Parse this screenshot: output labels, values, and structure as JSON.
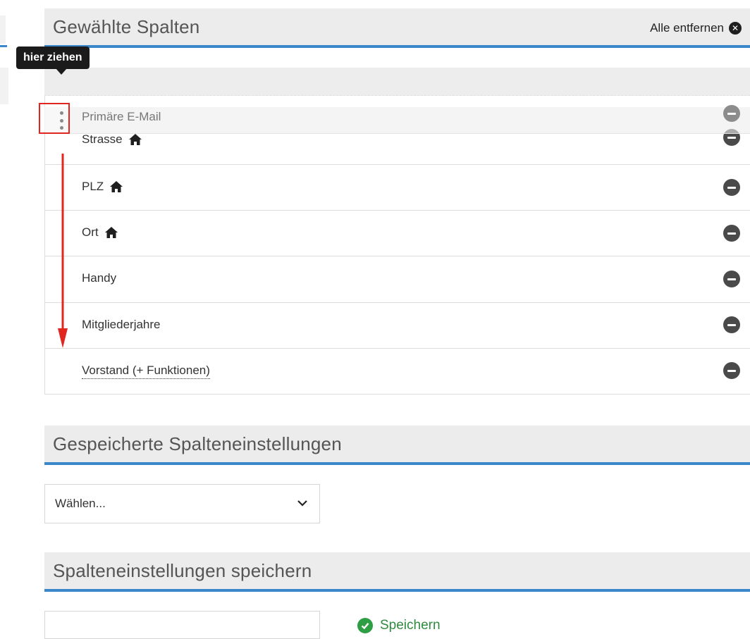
{
  "selected_columns": {
    "title": "Gewählte Spalten",
    "remove_all_label": "Alle entfernen",
    "drag_tooltip": "hier ziehen",
    "dragged_item": "Primäre E-Mail",
    "items": [
      {
        "label": "Strasse",
        "icon": "home-icon"
      },
      {
        "label": "PLZ",
        "icon": "home-icon"
      },
      {
        "label": "Ort",
        "icon": "home-icon"
      },
      {
        "label": "Handy",
        "icon": ""
      },
      {
        "label": "Mitgliederjahre",
        "icon": ""
      },
      {
        "label": "Vorstand (+ Funktionen)",
        "icon": ""
      }
    ]
  },
  "saved_settings": {
    "title": "Gespeicherte Spalteneinstellungen",
    "select_value": "Wählen..."
  },
  "save_settings": {
    "title": "Spalteneinstellungen speichern",
    "input_value": "",
    "save_label": "Speichern"
  },
  "colors": {
    "accent": "#3a87c9",
    "highlight": "#e0261e",
    "success": "#2e8b3d"
  }
}
